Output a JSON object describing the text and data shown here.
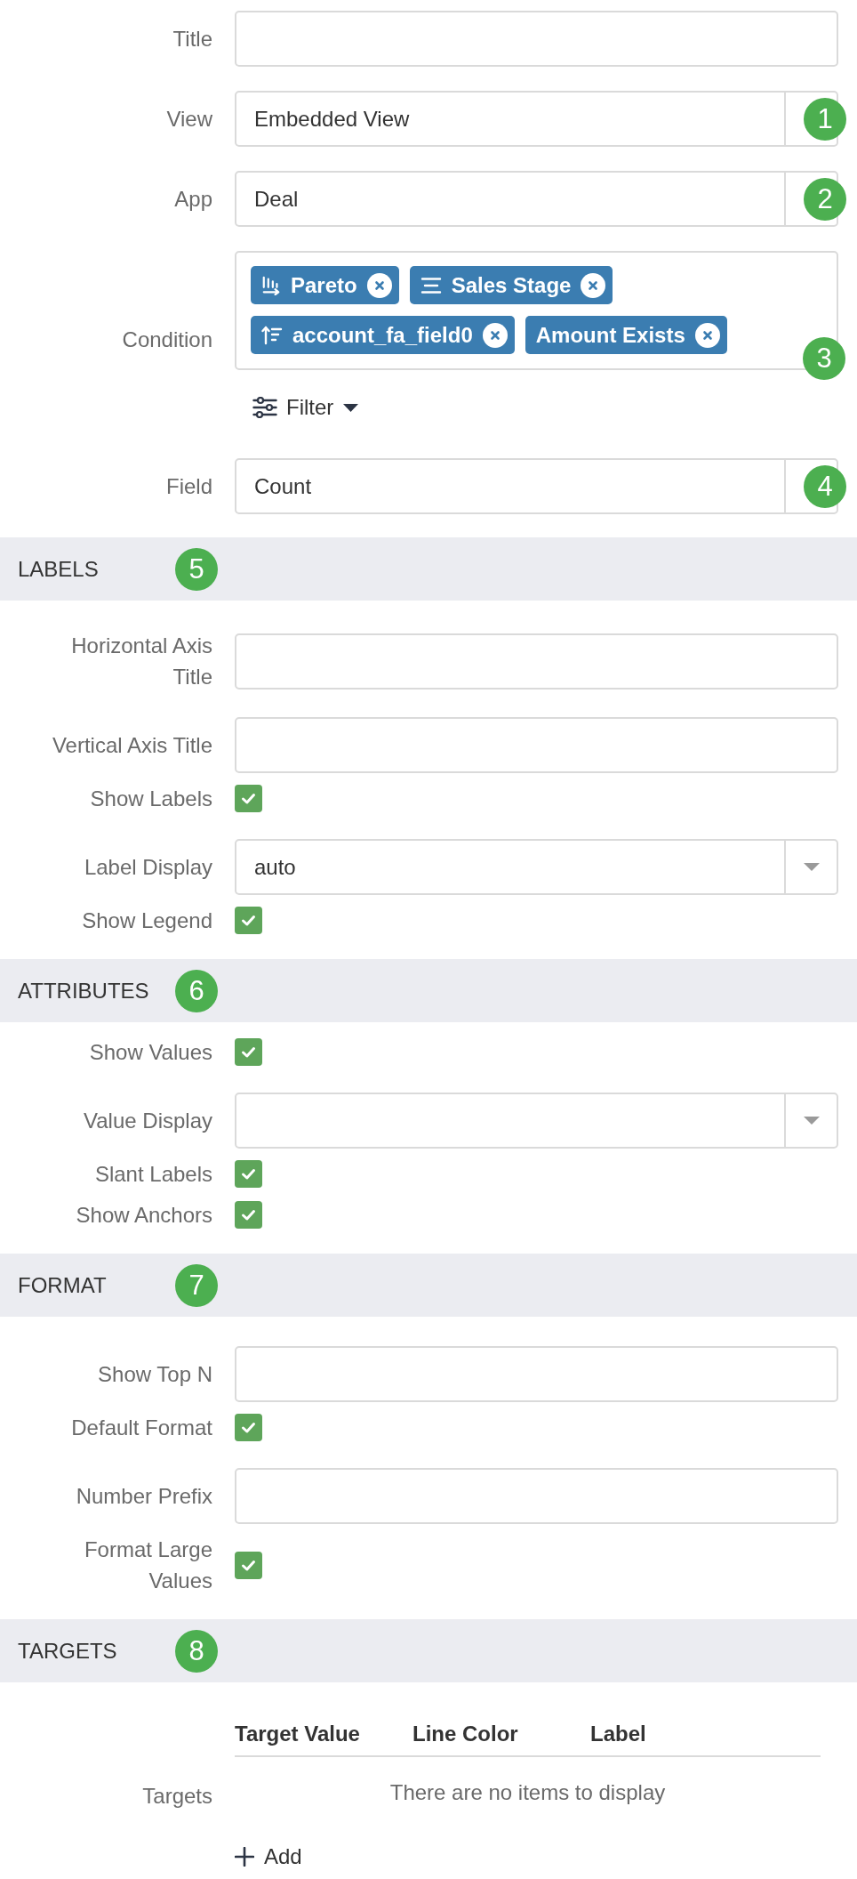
{
  "sections": [
    {
      "rows": [
        {
          "kind": "input",
          "label": "Title"
        },
        {
          "kind": "select",
          "label": "View",
          "value": "Embedded View",
          "badge": "1"
        },
        {
          "kind": "select",
          "label": "App",
          "value": "Deal",
          "badge": "2"
        },
        {
          "kind": "tags",
          "label": "Condition",
          "tags": [
            {
              "kind": "pareto",
              "text": "Pareto"
            },
            {
              "kind": "grouping",
              "text": "Sales Stage"
            },
            {
              "kind": "sorting",
              "text": "account_fa_field0"
            },
            {
              "kind": "plain",
              "text": "Amount Exists"
            }
          ],
          "badge": "3",
          "filter_button": "Filter"
        },
        {
          "kind": "select",
          "label": "Field",
          "value": "Count",
          "badge": "4"
        }
      ]
    },
    {
      "title": "LABELS",
      "badge": "5",
      "rows": [
        {
          "kind": "input",
          "label": "Horizontal Axis Title"
        },
        {
          "kind": "input",
          "label": "Vertical Axis Title"
        },
        {
          "kind": "checkbox",
          "label": "Show Labels",
          "checked": true
        },
        {
          "kind": "select",
          "label": "Label Display",
          "value": "auto"
        },
        {
          "kind": "checkbox",
          "label": "Show Legend",
          "checked": true
        }
      ]
    },
    {
      "title": "ATTRIBUTES",
      "badge": "6",
      "rows": [
        {
          "kind": "checkbox",
          "label": "Show Values",
          "checked": true
        },
        {
          "kind": "select",
          "label": "Value Display"
        },
        {
          "kind": "checkbox",
          "label": "Slant Labels",
          "checked": true
        },
        {
          "kind": "checkbox",
          "label": "Show Anchors",
          "checked": true
        }
      ]
    },
    {
      "title": "FORMAT",
      "badge": "7",
      "rows": [
        {
          "kind": "input",
          "label": "Show Top N"
        },
        {
          "kind": "checkbox",
          "label": "Default Format",
          "checked": true
        },
        {
          "kind": "input",
          "label": "Number Prefix"
        },
        {
          "kind": "checkbox",
          "label": "Format Large Values",
          "checked": true
        }
      ]
    },
    {
      "title": "TARGETS",
      "badge": "8",
      "rows": [
        {
          "kind": "table",
          "label": "Targets",
          "columns": [
            "Target Value",
            "Line Color",
            "Label"
          ],
          "empty_message": "There are no items to display",
          "add_button": "Add"
        }
      ]
    }
  ]
}
